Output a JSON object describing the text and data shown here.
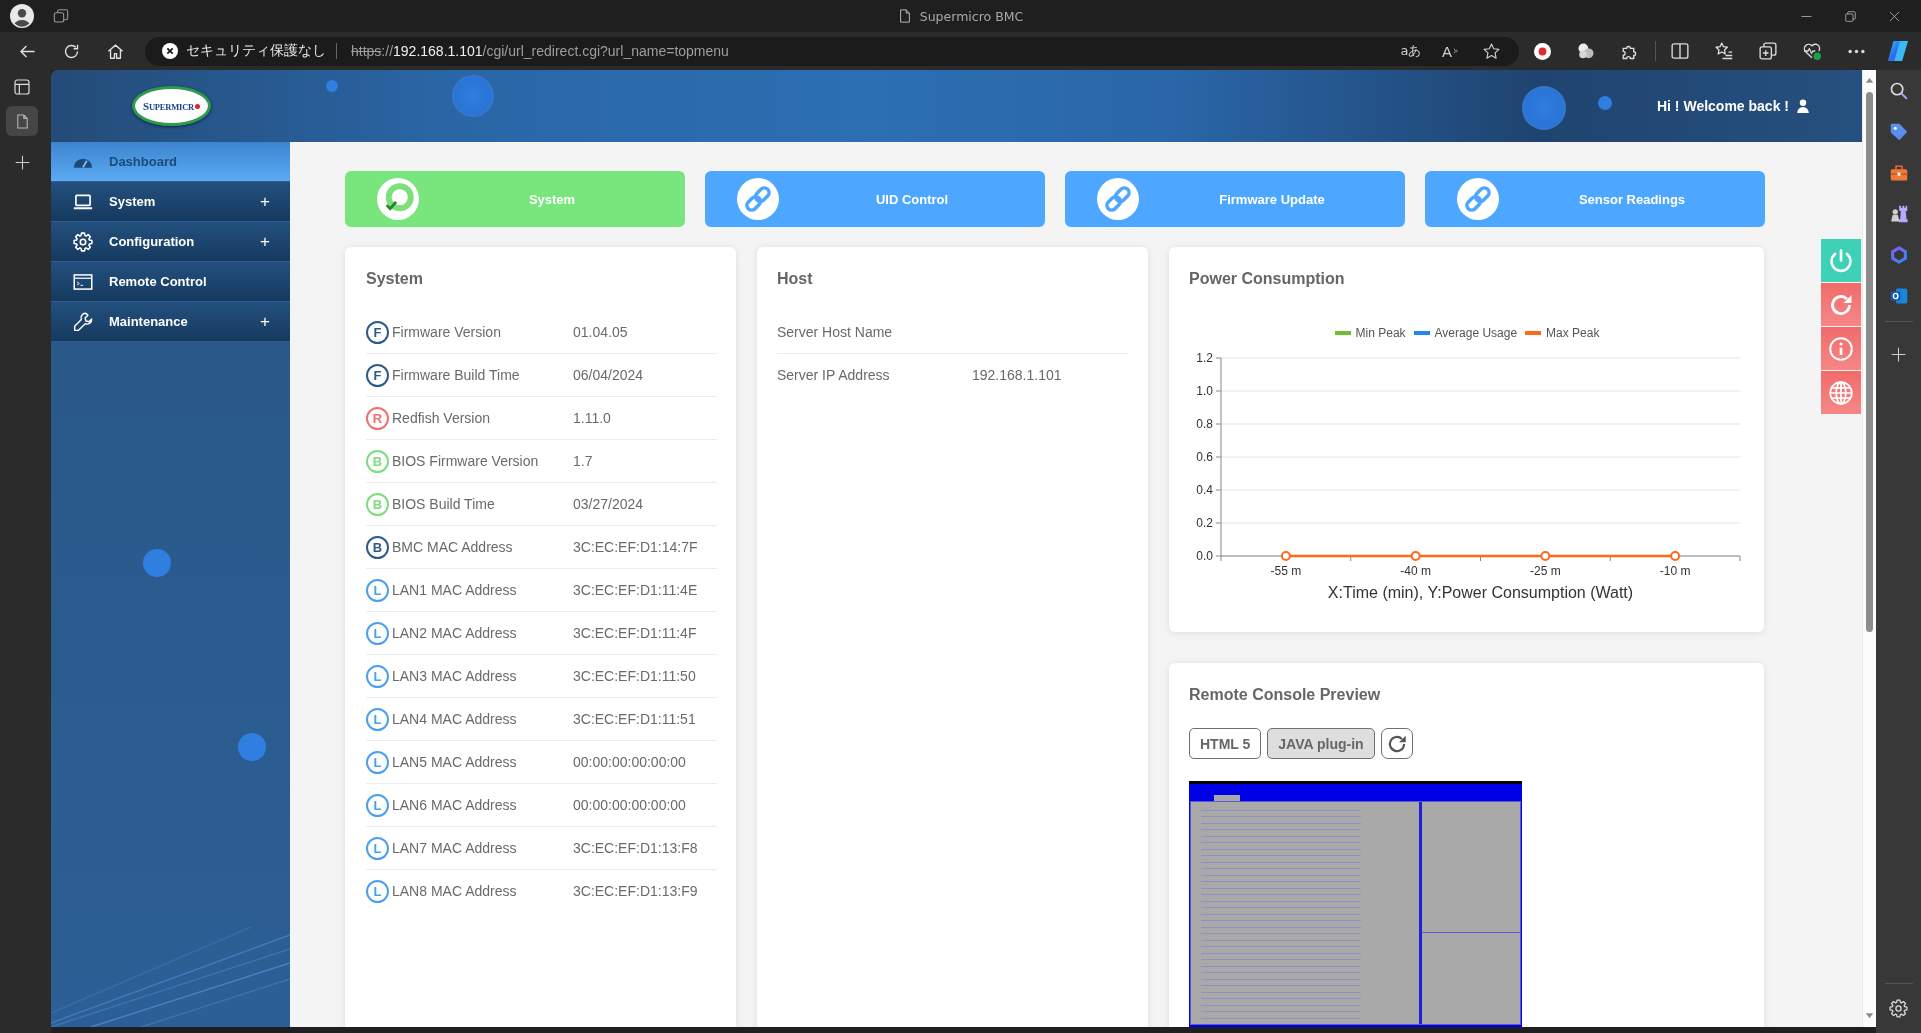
{
  "browser": {
    "title": "Supermicro BMC",
    "security_label": "セキュリティ保護なし",
    "url_scheme": "https",
    "url_separator": "://",
    "url_host": "192.168.1.101",
    "url_path": "/cgi/url_redirect.cgi?url_name=topmenu",
    "translate_label": "aあ",
    "read_aloud_label": "A"
  },
  "header": {
    "logo_text": "SUPERMICR",
    "greeting": "Hi ! Welcome back !"
  },
  "sidebar": {
    "items": [
      {
        "label": "Dashboard",
        "kind": "dashboard",
        "selected": true
      },
      {
        "label": "System",
        "kind": "system",
        "selected": false,
        "expander": "+"
      },
      {
        "label": "Configuration",
        "kind": "configuration",
        "selected": false,
        "expander": "+"
      },
      {
        "label": "Remote Control",
        "kind": "remote",
        "selected": false
      },
      {
        "label": "Maintenance",
        "kind": "maintenance",
        "selected": false,
        "expander": "+"
      }
    ]
  },
  "quick_links": [
    {
      "label": "System",
      "kind": "status"
    },
    {
      "label": "UID Control",
      "kind": "link"
    },
    {
      "label": "Firmware Update",
      "kind": "link"
    },
    {
      "label": "Sensor Readings",
      "kind": "link"
    }
  ],
  "system_card": {
    "title": "System",
    "rows": [
      {
        "badge": "F",
        "color": "#2d5a8a",
        "label": "Firmware Version",
        "value": "01.04.05"
      },
      {
        "badge": "F",
        "color": "#2d5a8a",
        "label": "Firmware Build Time",
        "value": "06/04/2024"
      },
      {
        "badge": "R",
        "color": "#f07070",
        "label": "Redfish Version",
        "value": "1.11.0"
      },
      {
        "badge": "B",
        "color": "#7ddc7d",
        "label": "BIOS Firmware Version",
        "value": "1.7"
      },
      {
        "badge": "B",
        "color": "#7ddc7d",
        "label": "BIOS Build Time",
        "value": "03/27/2024"
      },
      {
        "badge": "B",
        "color": "#2d5a8a",
        "label": "BMC MAC Address",
        "value": "3C:EC:EF:D1:14:7F"
      },
      {
        "badge": "L",
        "color": "#4aa0f0",
        "label": "LAN1 MAC Address",
        "value": "3C:EC:EF:D1:11:4E"
      },
      {
        "badge": "L",
        "color": "#4aa0f0",
        "label": "LAN2 MAC Address",
        "value": "3C:EC:EF:D1:11:4F"
      },
      {
        "badge": "L",
        "color": "#4aa0f0",
        "label": "LAN3 MAC Address",
        "value": "3C:EC:EF:D1:11:50"
      },
      {
        "badge": "L",
        "color": "#4aa0f0",
        "label": "LAN4 MAC Address",
        "value": "3C:EC:EF:D1:11:51"
      },
      {
        "badge": "L",
        "color": "#4aa0f0",
        "label": "LAN5 MAC Address",
        "value": "00:00:00:00:00:00"
      },
      {
        "badge": "L",
        "color": "#4aa0f0",
        "label": "LAN6 MAC Address",
        "value": "00:00:00:00:00:00"
      },
      {
        "badge": "L",
        "color": "#4aa0f0",
        "label": "LAN7 MAC Address",
        "value": "3C:EC:EF:D1:13:F8"
      },
      {
        "badge": "L",
        "color": "#4aa0f0",
        "label": "LAN8 MAC Address",
        "value": "3C:EC:EF:D1:13:F9"
      }
    ]
  },
  "host_card": {
    "title": "Host",
    "rows": [
      {
        "label": "Server Host Name"
      },
      {
        "label": "Server IP Address",
        "value": "192.168.1.101"
      }
    ]
  },
  "power_card": {
    "title": "Power Consumption",
    "chart_data": {
      "type": "line",
      "legend": "top",
      "grid": true,
      "xlabel": "X:Time (min), Y:Power Consumption (Watt)",
      "categories": [
        "-55 m",
        "-40 m",
        "-25 m",
        "-10 m"
      ],
      "series": [
        {
          "name": "Min Peak",
          "color": "#6cc02c",
          "values": [
            null,
            null,
            null,
            null
          ]
        },
        {
          "name": "Average Usage",
          "color": "#1e88f0",
          "values": [
            null,
            null,
            null,
            null
          ]
        },
        {
          "name": "Max Peak",
          "color": "#ff6a1a",
          "marker": "circle",
          "values": [
            0,
            0,
            0,
            0
          ]
        }
      ],
      "ylim": [
        0,
        1.2
      ],
      "yticks": [
        {
          "value": 0,
          "label": "0.0"
        },
        {
          "value": 0.2,
          "label": "0.2"
        },
        {
          "value": 0.4,
          "label": "0.4"
        },
        {
          "value": 0.6,
          "label": "0.6"
        },
        {
          "value": 0.8,
          "label": "0.8"
        },
        {
          "value": 1,
          "label": "1.0"
        },
        {
          "value": 1.2,
          "label": "1.2"
        }
      ]
    }
  },
  "console_card": {
    "title": "Remote Console Preview",
    "buttons": [
      {
        "label": "HTML 5",
        "disabled": false
      },
      {
        "label": "JAVA plug-in",
        "disabled": true
      }
    ]
  }
}
